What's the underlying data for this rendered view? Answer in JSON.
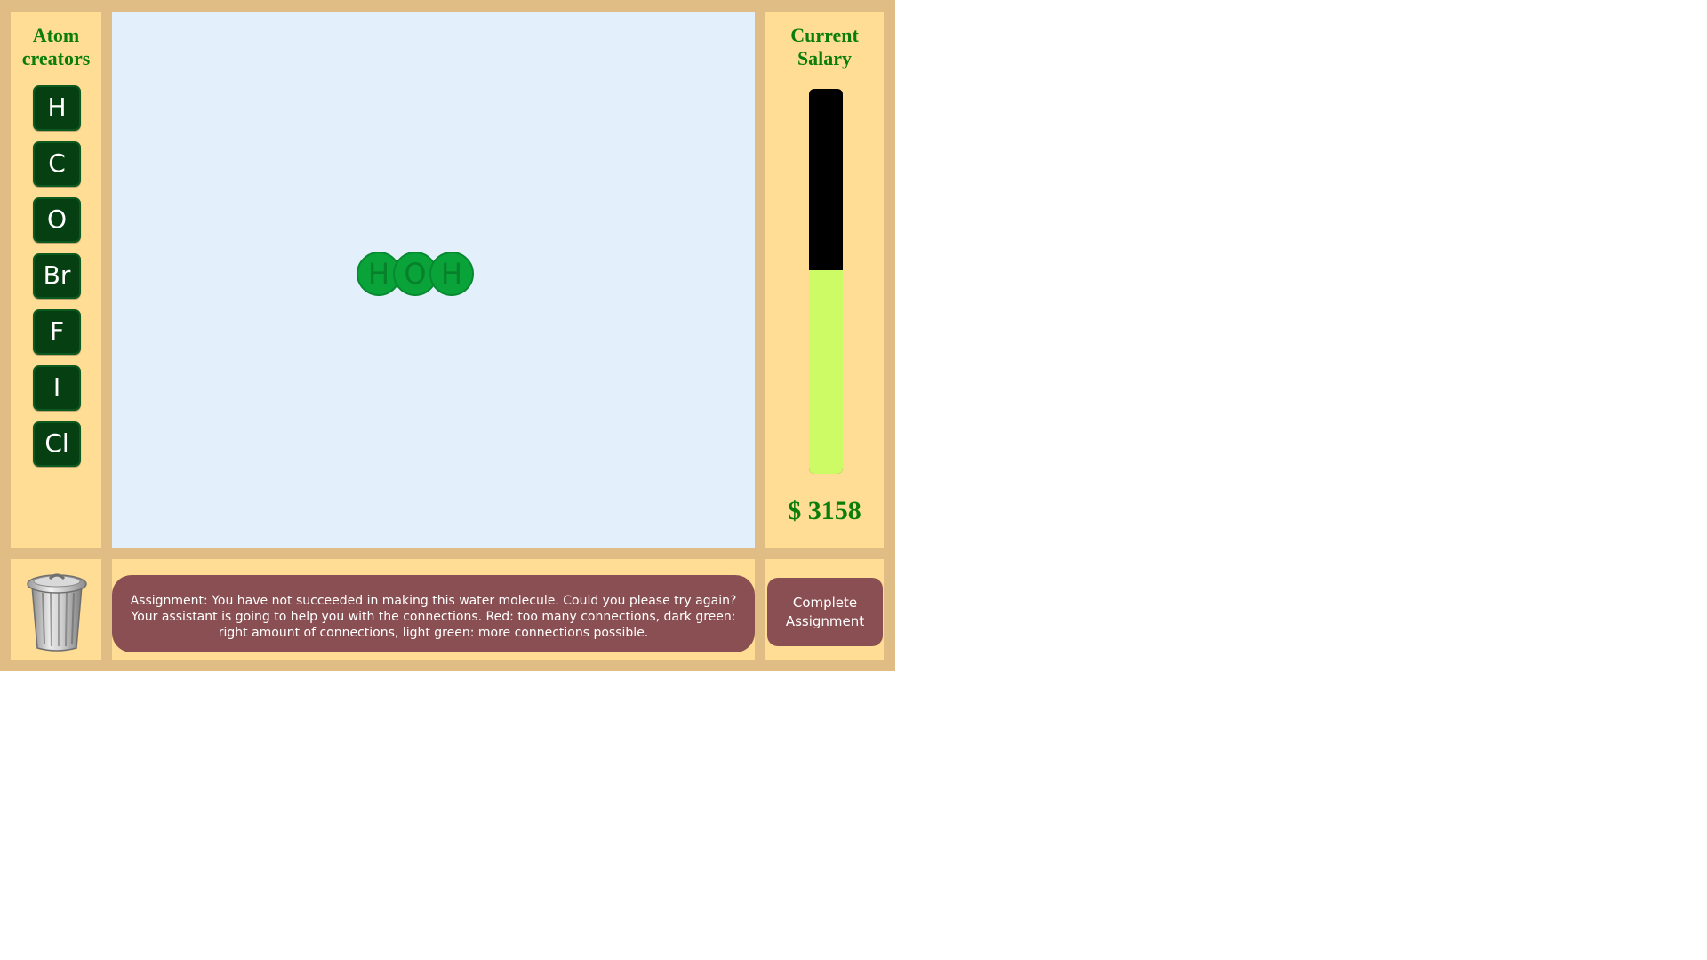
{
  "atom_creators": {
    "title": "Atom creators",
    "buttons": [
      {
        "symbol": "H"
      },
      {
        "symbol": "C"
      },
      {
        "symbol": "O"
      },
      {
        "symbol": "Br"
      },
      {
        "symbol": "F"
      },
      {
        "symbol": "I"
      },
      {
        "symbol": "Cl"
      }
    ]
  },
  "molecule": {
    "atoms": [
      {
        "symbol": "H"
      },
      {
        "symbol": "O"
      },
      {
        "symbol": "H"
      }
    ]
  },
  "salary": {
    "title": "Current Salary",
    "amount": "$ 3158",
    "level_fraction": 0.53
  },
  "assignment": {
    "message": "Assignment: You have not succeeded in making this water molecule. Could you please try again? Your assistant is going to help you with the connections. Red: too many connections, dark green: right amount of connections, light green: more connections possible."
  },
  "complete_button": {
    "label": "Complete Assignment"
  },
  "colors": {
    "frame": "#dfbd85",
    "panel": "#ffdd94",
    "canvas": "#e3f0fc",
    "title_green": "#0b7d0b",
    "atom_button": "#063f12",
    "atom_bubble": "#0aa33a",
    "salary_fill": "#ccfb66",
    "message_box": "#8a4f52"
  }
}
